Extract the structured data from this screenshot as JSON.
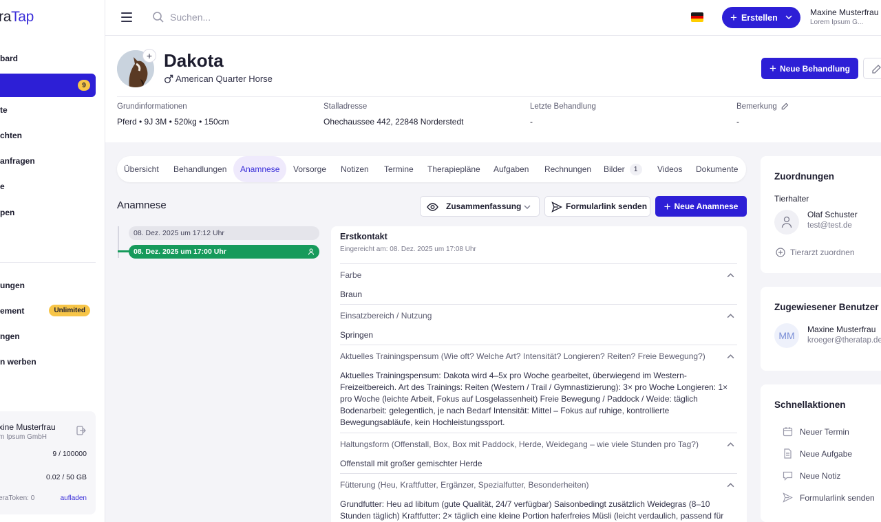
{
  "app": {
    "logo_part1": "ra",
    "logo_part2": "Tap"
  },
  "sidebar": {
    "items": [
      {
        "label": "bard"
      },
      {
        "label": "",
        "badge": "9"
      },
      {
        "label": "te"
      },
      {
        "label": "chten"
      },
      {
        "label": "anfragen"
      },
      {
        "label": "e"
      },
      {
        "label": "pen"
      },
      {
        "label": "ungen"
      },
      {
        "label": "ement",
        "badge": "Unlimited"
      },
      {
        "label": "ngen"
      },
      {
        "label": "n werben"
      }
    ],
    "user": {
      "name": "xine Musterfrau",
      "company": "m Ipsum GmbH",
      "stat1": "9 / 100000",
      "stat2": "0.02 / 50 GB",
      "token": "eraToken: 0",
      "reload": "aufladen"
    }
  },
  "topbar": {
    "search_placeholder": "Suchen...",
    "create_label": "Erstellen",
    "user_name": "Maxine Musterfrau",
    "user_company": "Lorem Ipsum G..."
  },
  "animal": {
    "name": "Dakota",
    "breed": "American Quarter Horse",
    "new_treatment": "Neue Behandlung",
    "info": [
      {
        "label": "Grundinformationen",
        "value": "Pferd  •  9J 3M • 520kg • 150cm"
      },
      {
        "label": "Stalladresse",
        "value": "Ohechaussee 442, 22848 Norderstedt"
      },
      {
        "label": "Letzte Behandlung",
        "value": "-"
      },
      {
        "label": "Bemerkung",
        "value": "-"
      }
    ]
  },
  "tabs": [
    {
      "label": "Übersicht"
    },
    {
      "label": "Behandlungen"
    },
    {
      "label": "Anamnese"
    },
    {
      "label": "Vorsorge"
    },
    {
      "label": "Notizen"
    },
    {
      "label": "Termine"
    },
    {
      "label": "Therapiepläne"
    },
    {
      "label": "Aufgaben"
    },
    {
      "label": "Rechnungen"
    },
    {
      "label": "Bilder",
      "count": "1"
    },
    {
      "label": "Videos"
    },
    {
      "label": "Dokumente"
    }
  ],
  "anamnese": {
    "title": "Anamnese",
    "summary_label": "Zusammenfassung",
    "form_link_label": "Formularlink senden",
    "new_label": "Neue Anamnese",
    "timeline": [
      {
        "label": "08. Dez. 2025 um 17:12 Uhr"
      },
      {
        "label": "08. Dez. 2025 um 17:00 Uhr"
      }
    ],
    "card": {
      "title": "Erstkontakt",
      "submitted": "Eingereicht am: 08. Dez. 2025 um 17:08 Uhr",
      "qa": [
        {
          "q": "Farbe",
          "a": "Braun"
        },
        {
          "q": "Einsatzbereich / Nutzung",
          "a": "Springen"
        },
        {
          "q": "Aktuelles Trainingspensum (Wie oft? Welche Art? Intensität? Longieren? Reiten? Freie Bewegung?)",
          "a": "Aktuelles Trainingspensum: Dakota wird 4–5x pro Woche gearbeitet, überwiegend im Western-Freizeitbereich. Art des Trainings: Reiten (Western / Trail / Gymnastizierung): 3× pro Woche Longieren: 1× pro Woche (leichte Arbeit, Fokus auf Losgelassenheit) Freie Bewegung / Paddock / Weide: täglich Bodenarbeit: gelegentlich, je nach Bedarf Intensität: Mittel – Fokus auf ruhige, kontrollierte Bewegungsabläufe, kein Hochleistungssport."
        },
        {
          "q": "Haltungsform (Offenstall, Box, Box mit Paddock, Herde, Weidegang – wie viele Stunden pro Tag?)",
          "a": "Offenstall mit großer gemischter Herde"
        },
        {
          "q": "Fütterung (Heu, Kraftfutter, Ergänzer, Spezialfutter, Besonderheiten)",
          "a": "Grundfutter: Heu ad libitum (gute Qualität, 24/7 verfügbar) Saisonbedingt zusätzlich Weidegras (8–10 Stunden täglich) Kraftfutter: 2× täglich eine kleine Portion haferfreies Müsli (leicht verdaulich, passend für"
        }
      ]
    }
  },
  "right": {
    "assignments": {
      "title": "Zuordnungen",
      "owner_label": "Tierhalter",
      "owner_name": "Olaf Schuster",
      "owner_mail": "test@test.de",
      "assign_vet": "Tierarzt zuordnen"
    },
    "assigned_user": {
      "title": "Zugewiesener Benutzer",
      "initials": "MM",
      "name": "Maxine Musterfrau",
      "mail": "kroeger@theratap.de"
    },
    "quick": {
      "title": "Schnellaktionen",
      "items": [
        {
          "label": "Neuer Termin"
        },
        {
          "label": "Neue Aufgabe"
        },
        {
          "label": "Neue Notiz"
        },
        {
          "label": "Formularlink senden"
        }
      ]
    }
  },
  "colors": {
    "primary": "#2d1fd6",
    "accent_badge": "#f7c548",
    "active_timeline": "#169a5b"
  }
}
